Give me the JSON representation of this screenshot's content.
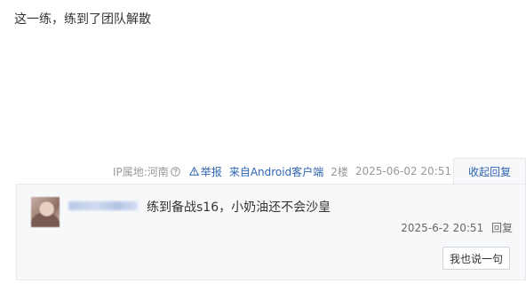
{
  "post": {
    "content": "这一练，练到了团队解散"
  },
  "post_tail": {
    "ip_location": "IP属地:河南",
    "report_label": "举报",
    "client_source": "来自Android客户端",
    "floor": "2楼",
    "timestamp": "2025-06-02 20:51",
    "collapse_reply_label": "收起回复"
  },
  "reply": {
    "text": "练到备战s16，小奶油还不会沙皇",
    "timestamp": "2025-6-2 20:51",
    "reply_label": "回复"
  },
  "reply_input": {
    "button_label": "我也说一句"
  },
  "colors": {
    "link": "#2d64b3",
    "muted_text": "#999999",
    "panel_bg": "#f7f8fa"
  }
}
